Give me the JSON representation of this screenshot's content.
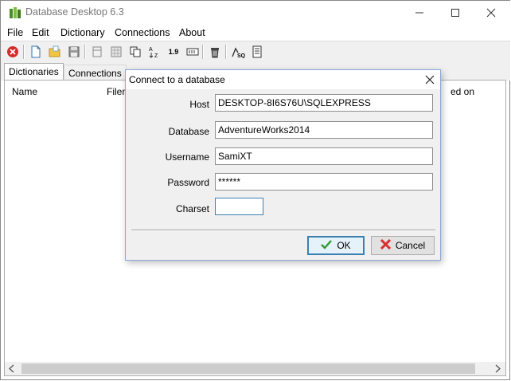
{
  "window": {
    "title": "Database Desktop 6.3"
  },
  "menu": [
    "File",
    "Edit",
    "Dictionary",
    "Connections",
    "About"
  ],
  "tabs": {
    "dictionaries": "Dictionaries",
    "connections": "Connections"
  },
  "list": {
    "columns": {
      "name": "Name",
      "filename": "Filen",
      "modified": "ed on"
    }
  },
  "dialog": {
    "title": "Connect to a database",
    "host_label": "Host",
    "host_value": "DESKTOP-8I6S76U\\SQLEXPRESS",
    "database_label": "Database",
    "database_value": "AdventureWorks2014",
    "username_label": "Username",
    "username_value": "SamiXT",
    "password_label": "Password",
    "password_value": "******",
    "charset_label": "Charset",
    "charset_value": "",
    "ok_label": "OK",
    "cancel_label": "Cancel"
  },
  "toolbar": {
    "number_format_label": "1.9"
  },
  "colors": {
    "accent": "#3c7fb1",
    "ok_check": "#2f9a2f",
    "cancel_x": "#d83030"
  }
}
